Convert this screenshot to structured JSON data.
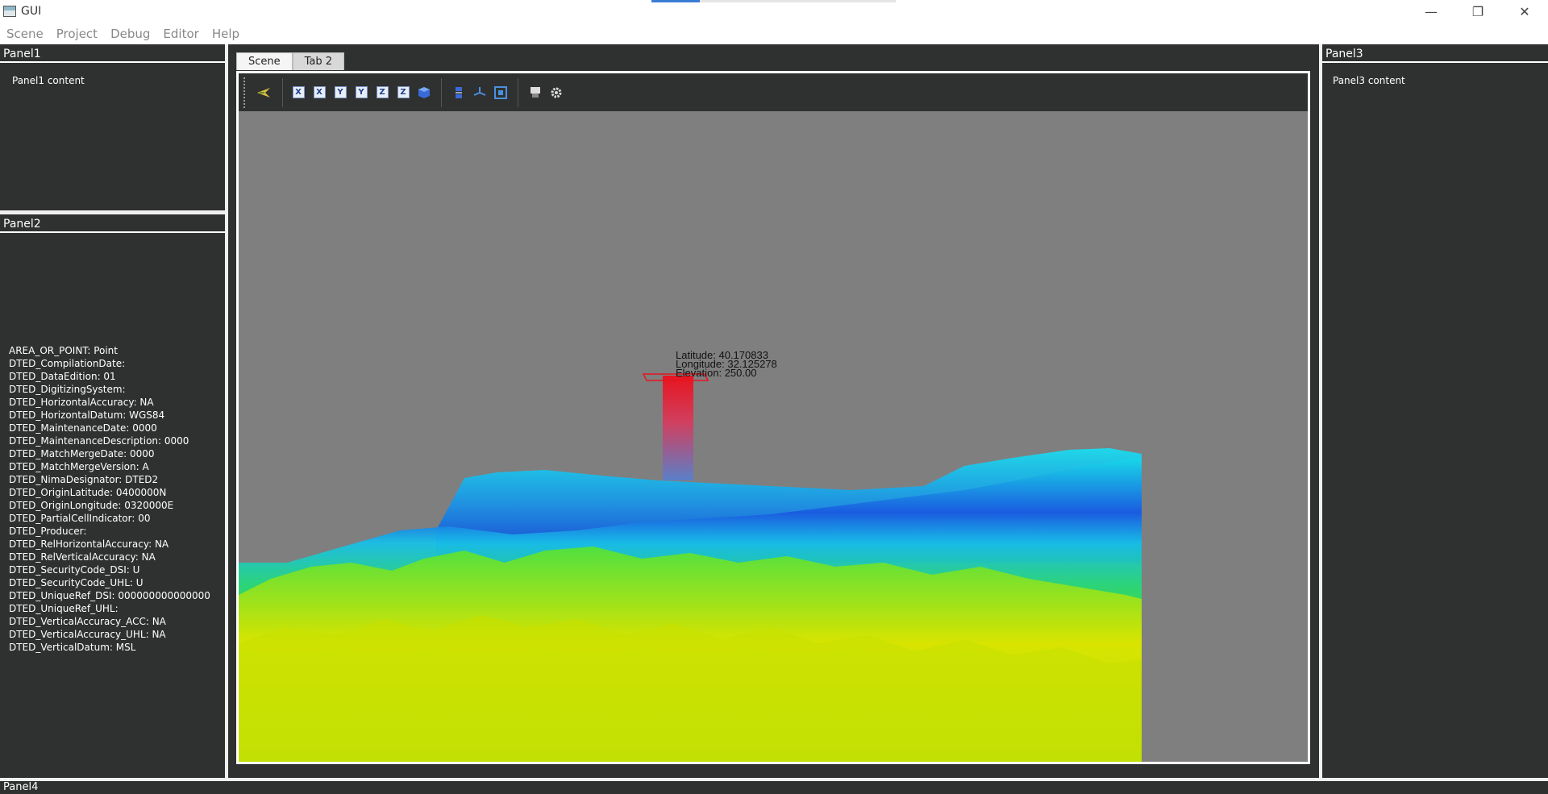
{
  "window": {
    "title": "GUI",
    "controls": {
      "minimize": "—",
      "maximize": "❐",
      "close": "✕"
    }
  },
  "menubar": {
    "items": [
      "Scene",
      "Project",
      "Debug",
      "Editor",
      "Help"
    ]
  },
  "panel1": {
    "title": "Panel1",
    "content": "Panel1 content"
  },
  "panel2": {
    "title": "Panel2",
    "metadata": [
      "AREA_OR_POINT: Point",
      "DTED_CompilationDate:",
      "DTED_DataEdition: 01",
      "DTED_DigitizingSystem:",
      "DTED_HorizontalAccuracy: NA",
      "DTED_HorizontalDatum: WGS84",
      "DTED_MaintenanceDate: 0000",
      "DTED_MaintenanceDescription: 0000",
      "DTED_MatchMergeDate: 0000",
      "DTED_MatchMergeVersion: A",
      "DTED_NimaDesignator: DTED2",
      "DTED_OriginLatitude: 0400000N",
      "DTED_OriginLongitude: 0320000E",
      "DTED_PartialCellIndicator: 00",
      "DTED_Producer:",
      "DTED_RelHorizontalAccuracy: NA",
      "DTED_RelVerticalAccuracy: NA",
      "DTED_SecurityCode_DSI: U",
      "DTED_SecurityCode_UHL: U",
      "DTED_UniqueRef_DSI: 000000000000000",
      "DTED_UniqueRef_UHL:",
      "DTED_VerticalAccuracy_ACC: NA",
      "DTED_VerticalAccuracy_UHL: NA",
      "DTED_VerticalDatum: MSL"
    ]
  },
  "panel3": {
    "title": "Panel3",
    "content": "Panel3 content"
  },
  "panel4": {
    "title": "Panel4"
  },
  "tabs": [
    {
      "label": "Scene",
      "active": true
    },
    {
      "label": "Tab 2",
      "active": false
    }
  ],
  "toolbar": {
    "buttons": [
      {
        "icon": "select-arrow-icon",
        "label": ""
      },
      {
        "icon": "view-x-plus-icon",
        "label": "X"
      },
      {
        "icon": "view-x-minus-icon",
        "label": "X"
      },
      {
        "icon": "view-y-plus-icon",
        "label": "Y"
      },
      {
        "icon": "view-y-minus-icon",
        "label": "Y"
      },
      {
        "icon": "view-z-plus-icon",
        "label": "Z"
      },
      {
        "icon": "view-z-minus-icon",
        "label": "Z"
      },
      {
        "icon": "cube-icon",
        "label": ""
      },
      {
        "icon": "layers-icon",
        "label": ""
      },
      {
        "icon": "axes-icon",
        "label": ""
      },
      {
        "icon": "fit-view-icon",
        "label": ""
      },
      {
        "icon": "screenshot-icon",
        "label": ""
      },
      {
        "icon": "settings-gear-icon",
        "label": ""
      }
    ]
  },
  "scene": {
    "marker": {
      "latitude": "Latitude: 40.170833",
      "longitude": "Longitude: 32.125278",
      "elevation": "Elevation: 250.00"
    },
    "colors": {
      "background": "#7f7f7f",
      "marker_top": "#e8141e",
      "marker_bottom": "#5a7fc8",
      "terrain_low": "#1a40e0",
      "terrain_mid": "#18d0e0",
      "terrain_green": "#30d040",
      "terrain_high": "#e6e600"
    }
  }
}
